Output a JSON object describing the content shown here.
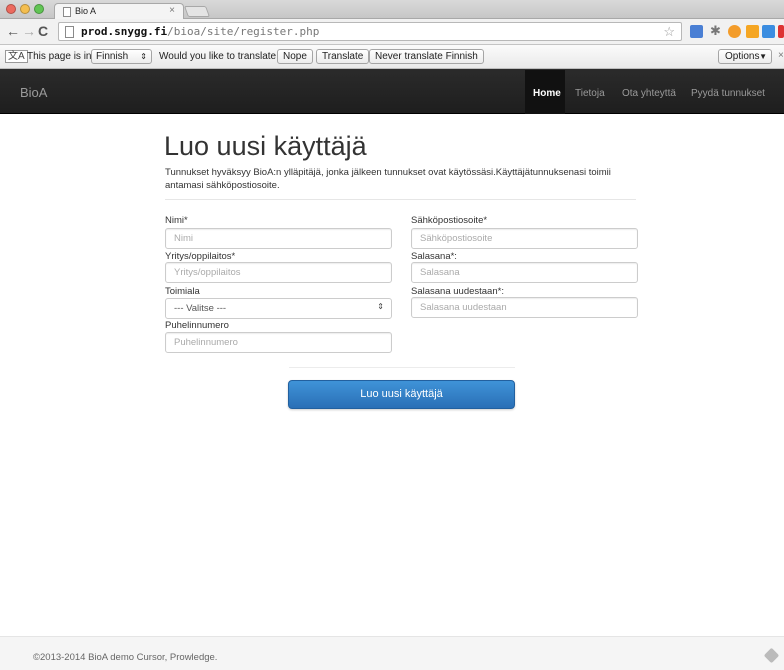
{
  "browser": {
    "tab_title": "Bio A",
    "tab_close": "×",
    "url_host": "prod.snygg.fi",
    "url_path": "/bioa/site/register.php"
  },
  "translate_bar": {
    "prefix": "This page is in",
    "language": "Finnish",
    "question": "Would you like to translate it?",
    "nope": "Nope",
    "translate": "Translate",
    "never": "Never translate Finnish",
    "options": "Options"
  },
  "navbar": {
    "brand": "BioA",
    "items": [
      {
        "label": "Home",
        "active": true
      },
      {
        "label": "Tietoja"
      },
      {
        "label": "Ota yhteyttä"
      },
      {
        "label": "Pyydä tunnukset"
      }
    ]
  },
  "form": {
    "title": "Luo uusi käyttäjä",
    "intro": "Tunnukset hyväksyy BioA:n ylläpitäjä, jonka jälkeen tunnukset ovat käytössäsi.Käyttäjätunnuksenasi toimii antamasi sähköpostiosoite.",
    "name_label": "Nimi*",
    "name_placeholder": "Nimi",
    "company_label": "Yritys/oppilaitos*",
    "company_placeholder": "Yritys/oppilaitos",
    "industry_label": "Toimiala",
    "industry_value": "--- Valitse ---",
    "phone_label": "Puhelinnumero",
    "phone_placeholder": "Puhelinnumero",
    "email_label": "Sähköpostiosoite*",
    "email_placeholder": "Sähköpostiosoite",
    "password_label": "Salasana*:",
    "password_placeholder": "Salasana",
    "password2_label": "Salasana uudestaan*:",
    "password2_placeholder": "Salasana uudestaan",
    "submit": "Luo uusi käyttäjä"
  },
  "footer": {
    "text": "©2013-2014 BioA demo Cursor, Prowledge."
  },
  "colors": {
    "navbar": "#222222",
    "submit": "#3278c0"
  }
}
